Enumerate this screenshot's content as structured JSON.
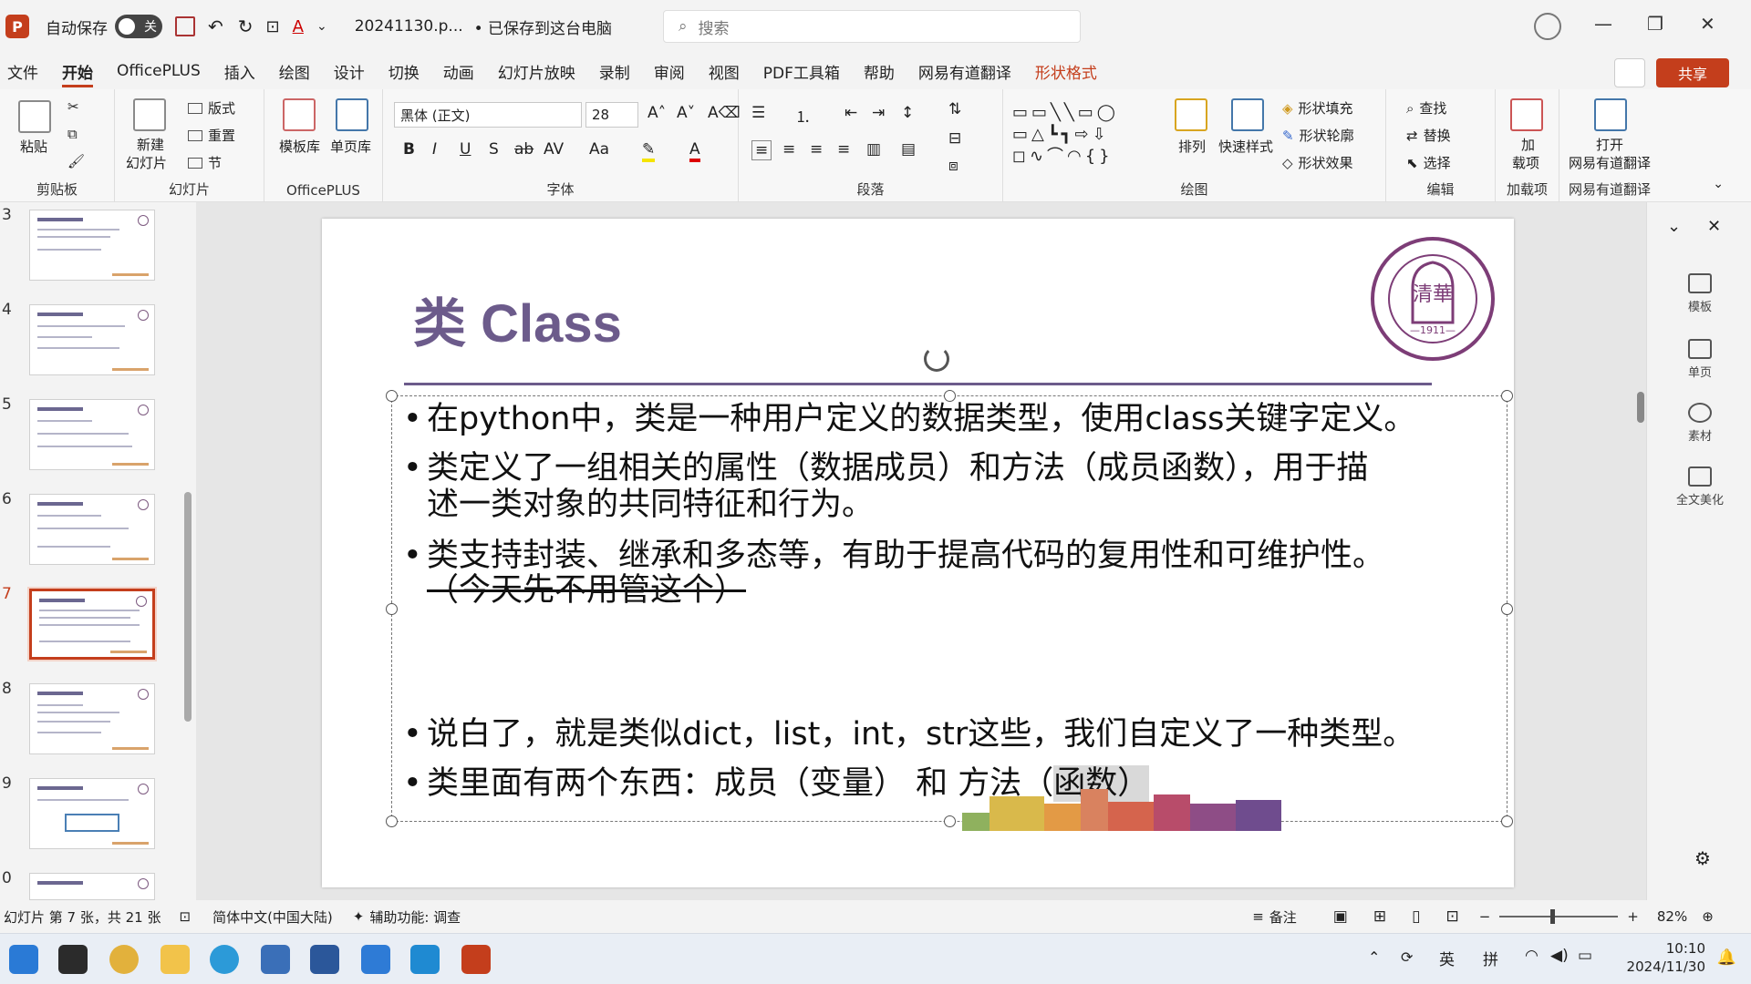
{
  "titlebar": {
    "autosave_label": "自动保存",
    "autosave_state": "关",
    "filename": "20241130.p...",
    "save_status": "• 已保存到这台电脑",
    "search_placeholder": "搜索"
  },
  "menu": {
    "tabs": [
      "文件",
      "开始",
      "OfficePLUS",
      "插入",
      "绘图",
      "设计",
      "切换",
      "动画",
      "幻灯片放映",
      "录制",
      "审阅",
      "视图",
      "PDF工具箱",
      "帮助",
      "网易有道翻译",
      "形状格式"
    ],
    "active_tab": "开始",
    "share_label": "共享"
  },
  "ribbon": {
    "clipboard": {
      "paste": "粘贴",
      "label": "剪贴板"
    },
    "slides": {
      "new_slide": "新建",
      "new_slide2": "幻灯片",
      "layout": "版式",
      "reset": "重置",
      "section": "节",
      "label": "幻灯片"
    },
    "officeplus": {
      "template": "模板库",
      "single": "单页库",
      "label": "OfficePLUS"
    },
    "font": {
      "name": "黑体 (正文)",
      "size": "28",
      "label": "字体",
      "bold": "B",
      "italic": "I",
      "underline": "U",
      "shadow": "S",
      "strike": "ab",
      "spacing": "AV",
      "case": "Aa"
    },
    "paragraph": {
      "label": "段落"
    },
    "drawing": {
      "arrange": "排列",
      "quick_styles": "快速样式",
      "fill": "形状填充",
      "outline": "形状轮廓",
      "effect": "形状效果",
      "label": "绘图"
    },
    "editing": {
      "find": "查找",
      "replace": "替换",
      "select": "选择",
      "label": "编辑"
    },
    "addins": {
      "addin": "加",
      "addin2": "载项",
      "label": "加载项"
    },
    "youdao": {
      "open": "打开",
      "open2": "网易有道翻译",
      "label": "网易有道翻译"
    }
  },
  "slides_panel": {
    "numbers": [
      "3",
      "4",
      "5",
      "6",
      "7",
      "8",
      "9",
      "0"
    ],
    "selected": "7"
  },
  "slide": {
    "title": "类 Class",
    "logo_year": "1911",
    "bullets": [
      "在python中，类是一种用户定义的数据类型，使用class关键字定义。",
      "类定义了一组相关的属性（数据成员）和方法（成员函数），用于描",
      "述一类对象的共同特征和行为。",
      "类支持封装、继承和多态等，有助于提高代码的复用性和可维护性。",
      "（今天先不用管这个）",
      "说白了，就是类似dict，list，int，str这些，我们自定义了一种类型。",
      "类里面有两个东西：成员（变量） 和 方法（",
      "函数）"
    ]
  },
  "right_panel": {
    "items": [
      "模板",
      "单页",
      "素材",
      "全文美化"
    ]
  },
  "statusbar": {
    "slide_info": "幻灯片 第 7 张，共 21 张",
    "language": "简体中文(中国大陆)",
    "accessibility": "辅助功能: 调查",
    "notes": "备注",
    "zoom": "82%"
  },
  "taskbar": {
    "time": "10:10",
    "date": "2024/11/30",
    "ime1": "英",
    "ime2": "拼"
  }
}
